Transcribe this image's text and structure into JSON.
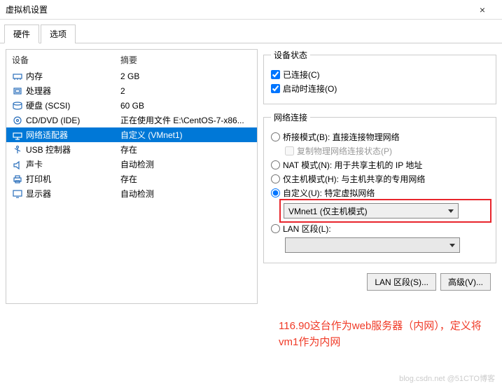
{
  "title": "虚拟机设置",
  "tabs": {
    "hardware": "硬件",
    "options": "选项"
  },
  "headers": {
    "device": "设备",
    "summary": "摘要"
  },
  "devices": [
    {
      "name": "内存",
      "summary": "2 GB",
      "icon": "memory"
    },
    {
      "name": "处理器",
      "summary": "2",
      "icon": "cpu"
    },
    {
      "name": "硬盘 (SCSI)",
      "summary": "60 GB",
      "icon": "disk"
    },
    {
      "name": "CD/DVD (IDE)",
      "summary": "正在使用文件 E:\\CentOS-7-x86...",
      "icon": "cd"
    },
    {
      "name": "网络适配器",
      "summary": "自定义 (VMnet1)",
      "icon": "net"
    },
    {
      "name": "USB 控制器",
      "summary": "存在",
      "icon": "usb"
    },
    {
      "name": "声卡",
      "summary": "自动检测",
      "icon": "sound"
    },
    {
      "name": "打印机",
      "summary": "存在",
      "icon": "printer"
    },
    {
      "name": "显示器",
      "summary": "自动检测",
      "icon": "display"
    }
  ],
  "status": {
    "legend": "设备状态",
    "connected": "已连接(C)",
    "connect_on": "启动时连接(O)"
  },
  "net": {
    "legend": "网络连接",
    "bridged": "桥接模式(B): 直接连接物理网络",
    "replicate": "复制物理网络连接状态(P)",
    "nat": "NAT 模式(N): 用于共享主机的 IP 地址",
    "hostonly": "仅主机模式(H): 与主机共享的专用网络",
    "custom": "自定义(U): 特定虚拟网络",
    "custom_value": "VMnet1 (仅主机模式)",
    "lan": "LAN 区段(L):",
    "lan_value": ""
  },
  "buttons": {
    "lan_seg": "LAN 区段(S)...",
    "advanced": "高级(V)..."
  },
  "annotation": "116.90这台作为web服务器（内网），定义将vm1作为内网",
  "watermark": "blog.csdn.net @51CTO博客"
}
